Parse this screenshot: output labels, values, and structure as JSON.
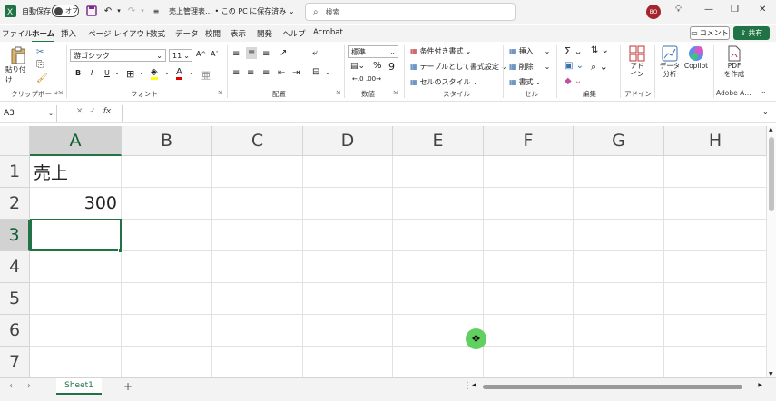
{
  "titlebar": {
    "autosave_label": "自動保存",
    "autosave_state": "オフ",
    "filename": "売上管理表… • この PC に保存済み",
    "search_placeholder": "検索",
    "user_initials": "BO"
  },
  "menu": {
    "tabs": [
      "ファイル",
      "ホーム",
      "挿入",
      "ページ レイアウト",
      "数式",
      "データ",
      "校閲",
      "表示",
      "開発",
      "ヘルプ",
      "Acrobat"
    ],
    "active_tab": "ホーム",
    "comment_label": "コメント",
    "share_label": "共有"
  },
  "ribbon": {
    "clipboard": {
      "paste_label": "貼り付け",
      "group_label": "クリップボード"
    },
    "font": {
      "font_name": "游ゴシック",
      "font_size": "11",
      "group_label": "フォント",
      "bold": "B",
      "italic": "I",
      "underline": "U"
    },
    "alignment": {
      "group_label": "配置"
    },
    "number": {
      "format": "標準",
      "percent": "%",
      "group_label": "数値"
    },
    "styles": {
      "conditional_format": "条件付き書式",
      "format_as_table": "テーブルとして書式設定",
      "cell_styles": "セルのスタイル",
      "group_label": "スタイル"
    },
    "cells": {
      "insert": "挿入",
      "delete": "削除",
      "format": "書式",
      "group_label": "セル"
    },
    "editing": {
      "group_label": "編集"
    },
    "addins": {
      "label": "アド\nイン",
      "group_label": "アドイン"
    },
    "data_analysis": {
      "label": "データ\n分析"
    },
    "copilot": {
      "label": "Copilot"
    },
    "adobe": {
      "label": "PDF\nを作成",
      "group_label": "Adobe A…"
    }
  },
  "formula_bar": {
    "name_box": "A3",
    "fx": "fx",
    "formula": ""
  },
  "sheet": {
    "columns": [
      "A",
      "B",
      "C",
      "D",
      "E",
      "F",
      "G",
      "H"
    ],
    "rows": [
      "1",
      "2",
      "3",
      "4",
      "5",
      "6",
      "7"
    ],
    "selected_column": "A",
    "selected_row": "3",
    "cells": {
      "A1": "売上",
      "A2": "300",
      "A3": ""
    }
  },
  "sheet_tabs": {
    "tabs": [
      "Sheet1"
    ],
    "active": "Sheet1",
    "add_label": "+"
  },
  "colors": {
    "accent": "#217346",
    "avatar": "#a4262c",
    "cursor": "#60d060"
  }
}
